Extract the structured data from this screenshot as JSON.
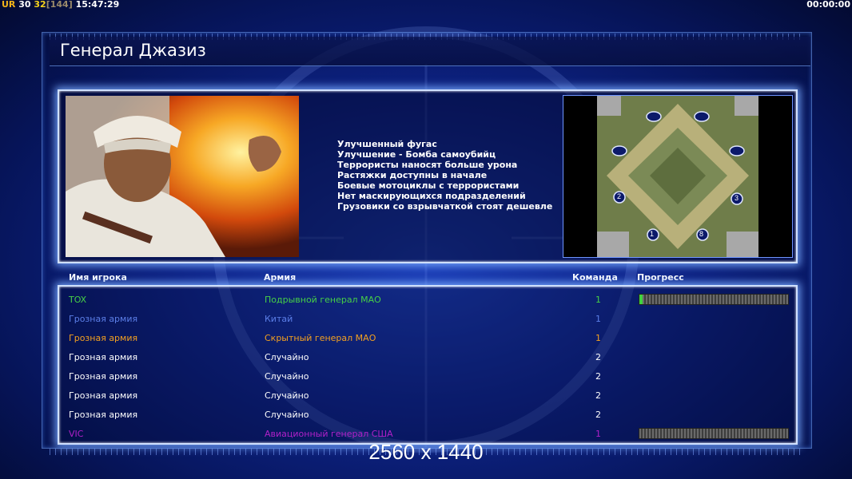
{
  "overlay": {
    "ur": "UR",
    "n1": "30",
    "n2": "32",
    "n3": "[144]",
    "clock": "15:47:29",
    "timer": "00:00:00"
  },
  "general": {
    "title": "Генерал Джазиз",
    "features": [
      "Улучшенный фугас",
      "Улучшение - Бомба самоубийц",
      "Террористы наносят больше урона",
      "Растяжки доступны в начале",
      "Боевые мотоциклы с террористами",
      "Нет маскирующихся подразделений",
      "Грузовики со взрывчаткой стоят дешевле"
    ]
  },
  "minimap": {
    "slots": [
      "1",
      "2",
      "3",
      "8"
    ]
  },
  "table": {
    "headers": {
      "player": "Имя игрока",
      "army": "Армия",
      "team": "Команда",
      "progress": "Прогресс"
    },
    "rows": [
      {
        "name": "TOX",
        "army": "Подрывной генерал МАО",
        "team": "1",
        "color": "#46d046",
        "progress": 0.02,
        "has_progress": true
      },
      {
        "name": "Грозная армия",
        "army": "Китай",
        "team": "1",
        "color": "#5c7fe8",
        "has_progress": false
      },
      {
        "name": "Грозная армия",
        "army": "Скрытный генерал МАО",
        "team": "1",
        "color": "#f3a020",
        "has_progress": false
      },
      {
        "name": "Грозная армия",
        "army": "Случайно",
        "team": "2",
        "color": "#ffffff",
        "has_progress": false
      },
      {
        "name": "Грозная армия",
        "army": "Случайно",
        "team": "2",
        "color": "#ffffff",
        "has_progress": false
      },
      {
        "name": "Грозная армия",
        "army": "Случайно",
        "team": "2",
        "color": "#ffffff",
        "has_progress": false
      },
      {
        "name": "Грозная армия",
        "army": "Случайно",
        "team": "2",
        "color": "#ffffff",
        "has_progress": false
      },
      {
        "name": "VIC",
        "army": "Авиационный генерал США",
        "team": "1",
        "color": "#b020c8",
        "progress": 0.0,
        "has_progress": true
      }
    ]
  },
  "resolution": "2560 x 1440"
}
